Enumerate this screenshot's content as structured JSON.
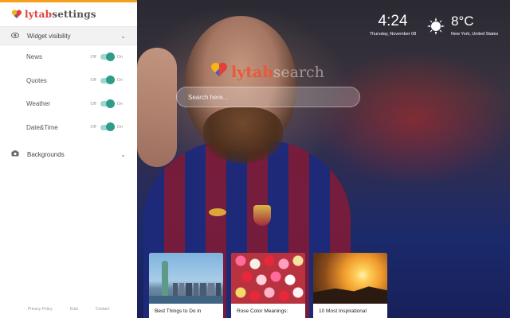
{
  "sidebar": {
    "logo_main": "lytab",
    "logo_sub": "settings",
    "widget_section": {
      "label": "Widget visibility",
      "icon": "eye-icon"
    },
    "toggles": [
      {
        "label": "News",
        "off": "Off",
        "on": "On"
      },
      {
        "label": "Quotes",
        "off": "Off",
        "on": "On"
      },
      {
        "label": "Weather",
        "off": "Off",
        "on": "On"
      },
      {
        "label": "Date&Time",
        "off": "Off",
        "on": "On"
      }
    ],
    "backgrounds_section": {
      "label": "Backgrounds",
      "icon": "camera-icon"
    },
    "footer": {
      "privacy": "Privacy Policy",
      "eula": "Eula",
      "contact": "Contact"
    }
  },
  "brand": {
    "main": "lytab",
    "sub": "search"
  },
  "search": {
    "placeholder": "Search here..."
  },
  "clock": {
    "time": "4:24",
    "date": "Thursday, November 08"
  },
  "weather": {
    "temp": "8°C",
    "location": "New York, United States",
    "icon": "sun-icon"
  },
  "cards": [
    {
      "title": "Best Things to Do in"
    },
    {
      "title": "Rose Color Meanings:"
    },
    {
      "title": "10 Most Inspirational"
    }
  ],
  "colors": {
    "accent": "#2f9c8a",
    "brand_red": "#e0413a",
    "top_bar": "#f4a01a"
  }
}
